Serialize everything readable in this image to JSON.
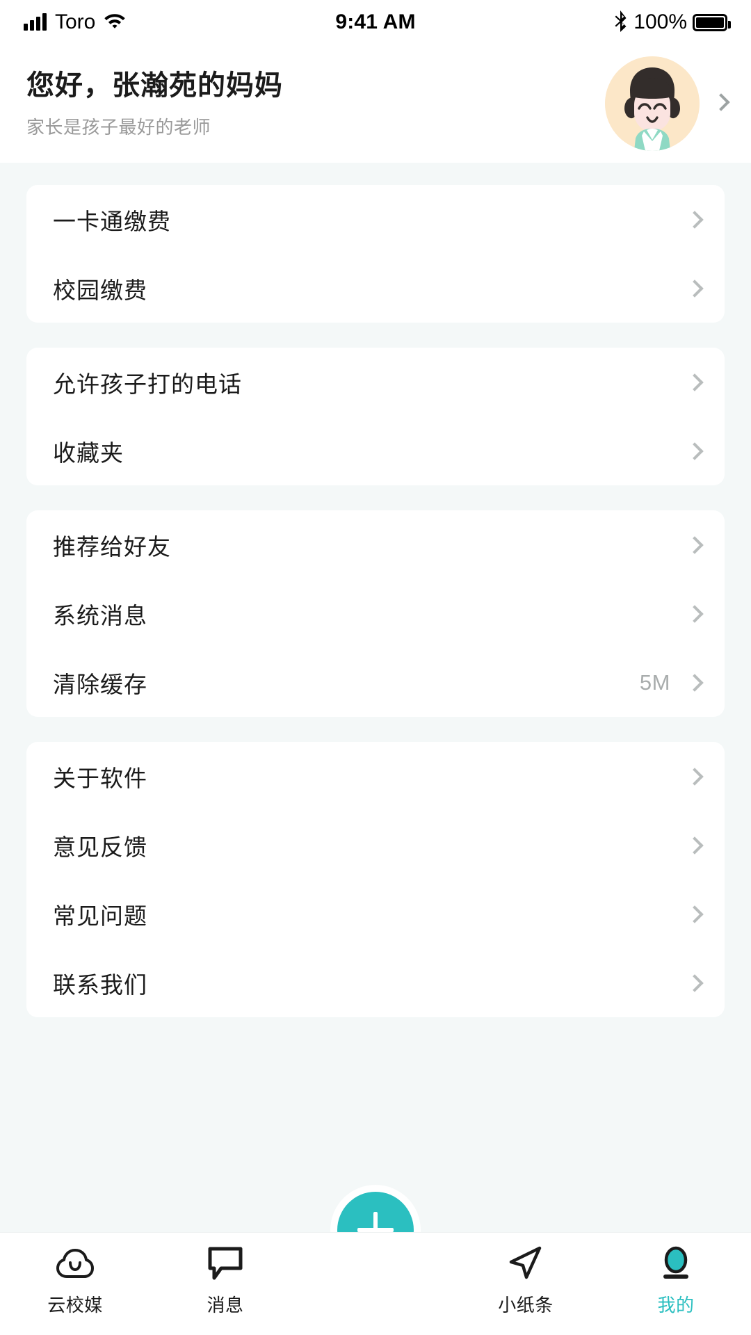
{
  "status_bar": {
    "carrier": "Toro",
    "time": "9:41 AM",
    "battery_percent": "100%",
    "wifi_icon": "wifi-icon",
    "bluetooth_icon": "bluetooth-icon",
    "signal_icon": "signal-bars-icon",
    "battery_icon": "battery-full-icon"
  },
  "header": {
    "greeting": "您好，张瀚苑的妈妈",
    "subtitle": "家长是孩子最好的老师",
    "avatar_icon": "avatar-illustration",
    "chevron_icon": "chevron-right-icon",
    "avatar_colors": {
      "background": "#FCE7C8",
      "hair": "#332D2B",
      "face": "#FBE3E0",
      "shirt": "#8FD9C4",
      "collar": "#FFFFFF"
    }
  },
  "colors": {
    "accent": "#2BBFC0",
    "page_background": "#F4F8F8",
    "card_background": "#FFFFFF",
    "primary_text": "#1B1B1B",
    "secondary_text": "#9A9A9A",
    "chevron": "#B9BDBD"
  },
  "cards": [
    {
      "rows": [
        {
          "label": "一卡通缴费",
          "value": "",
          "chevron_icon": "chevron-right-icon"
        },
        {
          "label": "校园缴费",
          "value": "",
          "chevron_icon": "chevron-right-icon"
        }
      ]
    },
    {
      "rows": [
        {
          "label": "允许孩子打的电话",
          "value": "",
          "chevron_icon": "chevron-right-icon"
        },
        {
          "label": "收藏夹",
          "value": "",
          "chevron_icon": "chevron-right-icon"
        }
      ]
    },
    {
      "rows": [
        {
          "label": "推荐给好友",
          "value": "",
          "chevron_icon": "chevron-right-icon"
        },
        {
          "label": "系统消息",
          "value": "",
          "chevron_icon": "chevron-right-icon"
        },
        {
          "label": "清除缓存",
          "value": "5M",
          "chevron_icon": "chevron-right-icon"
        }
      ]
    },
    {
      "rows": [
        {
          "label": "关于软件",
          "value": "",
          "chevron_icon": "chevron-right-icon"
        },
        {
          "label": "意见反馈",
          "value": "",
          "chevron_icon": "chevron-right-icon"
        },
        {
          "label": "常见问题",
          "value": "",
          "chevron_icon": "chevron-right-icon"
        },
        {
          "label": "联系我们",
          "value": "",
          "chevron_icon": "chevron-right-icon"
        }
      ]
    }
  ],
  "tabbar": {
    "tabs": [
      {
        "label": "云校媒",
        "icon": "cloud-icon",
        "active": false
      },
      {
        "label": "消息",
        "icon": "message-bubble-icon",
        "active": false
      },
      {
        "label": "小纸条",
        "icon": "paper-plane-icon",
        "active": false
      },
      {
        "label": "我的",
        "icon": "profile-icon",
        "active": true
      }
    ],
    "fab": {
      "icon": "plus-icon",
      "label": ""
    }
  }
}
